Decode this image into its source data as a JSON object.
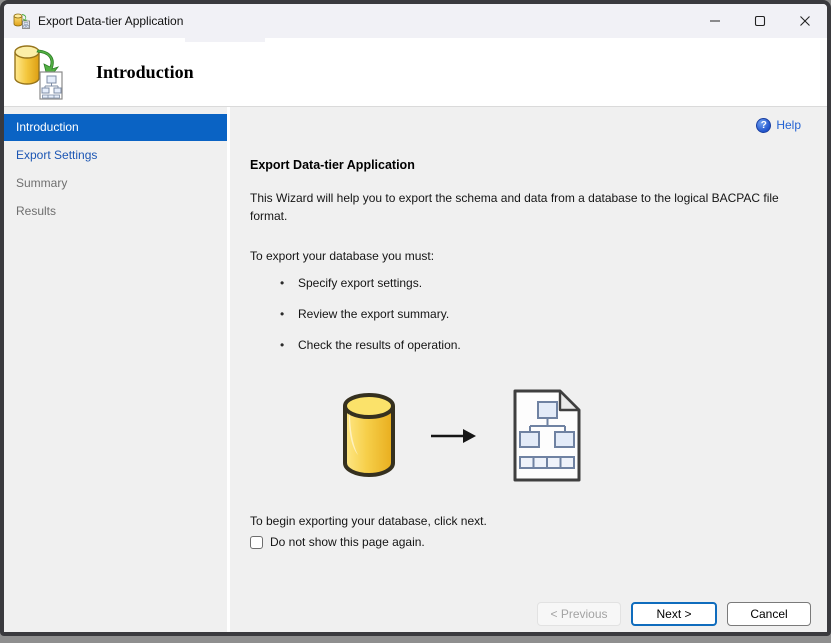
{
  "window": {
    "title": "Export Data-tier Application"
  },
  "icons": {
    "app": "database-export",
    "help": "?",
    "bullet": "•",
    "minimize": "minimize",
    "maximize": "maximize",
    "close": "close"
  },
  "header": {
    "title": "Introduction"
  },
  "sidebar": {
    "items": [
      {
        "label": "Introduction",
        "state": "active"
      },
      {
        "label": "Export Settings",
        "state": "enabled"
      },
      {
        "label": "Summary",
        "state": "disabled"
      },
      {
        "label": "Results",
        "state": "disabled"
      }
    ]
  },
  "content": {
    "help_label": "Help",
    "heading": "Export Data-tier Application",
    "intro_paragraph": "This Wizard will help you to export the schema and data from a database to the logical BACPAC file format.",
    "requirements_intro": "To export your database you must:",
    "bullets": [
      "Specify export settings.",
      "Review the export summary.",
      "Check the results of operation."
    ],
    "closing_note": "To begin exporting your database, click next.",
    "checkbox_label": "Do not show this page again.",
    "checkbox_checked": false
  },
  "footer": {
    "previous_label": "< Previous",
    "next_label": "Next >",
    "cancel_label": "Cancel"
  },
  "colors": {
    "accent_blue": "#0a63c4",
    "link_blue": "#1c56b4",
    "help_blue": "#2362d2",
    "next_button_border": "#0f6cbd",
    "titlebar_bg": "#f1f1f6",
    "panel_bg": "#f0f0f0",
    "header_bg": "#ffffff"
  }
}
